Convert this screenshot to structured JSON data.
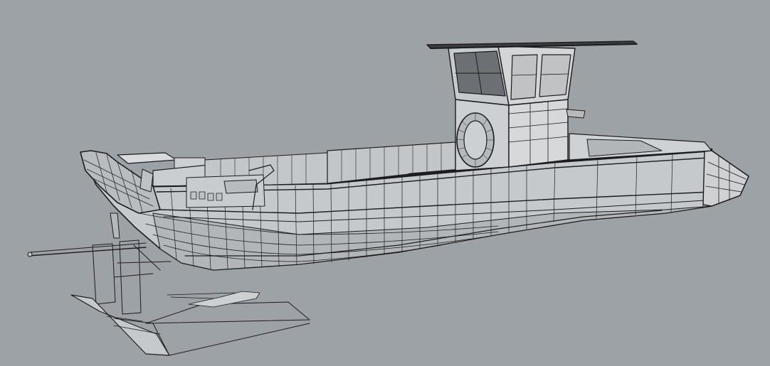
{
  "viewport": {
    "background": "#9da2a7",
    "render_mode": "shaded-wireframe",
    "subject": "boat-hull-model",
    "colors": {
      "line": "#1b1d20",
      "hull_fill": "#c9cbcd",
      "cabin_fill": "#d6d8d9",
      "window_fill": "#c1c3c5",
      "dark_window_fill": "#6d7074",
      "deck_fill": "#b7babd"
    }
  }
}
